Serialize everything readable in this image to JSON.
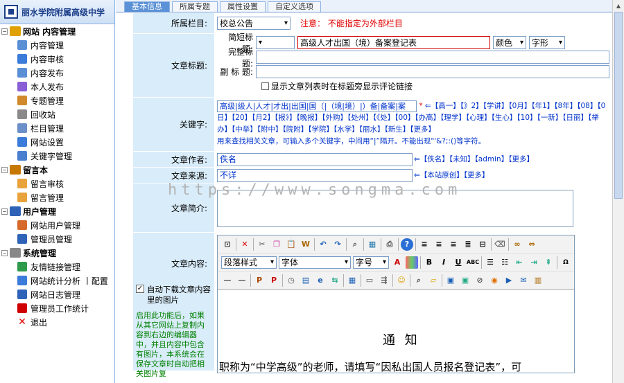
{
  "app": {
    "title": "丽水学院附属高级中学"
  },
  "sidebar": {
    "groups": [
      {
        "label": "网站 内容管理",
        "items": [
          "内容管理",
          "内容审核",
          "内容发布",
          "本人发布",
          "专题管理",
          "回收站",
          "栏目管理",
          "网站设置",
          "关键字管理"
        ]
      },
      {
        "label": "留言本",
        "items": [
          "留言审核",
          "留言管理"
        ]
      },
      {
        "label": "用户管理",
        "items": [
          "网站用户管理",
          "管理员管理"
        ]
      },
      {
        "label": "系统管理",
        "items": [
          "友情链接管理",
          "网站统计分析 丨配置",
          "网站日志管理",
          "管理员工作统计",
          "退出"
        ]
      }
    ]
  },
  "tabs": [
    "基本信息",
    "所属专题",
    "属性设置",
    "自定义选项"
  ],
  "form": {
    "category": {
      "label": "所属栏目:",
      "value": "校总公告",
      "note": "注意： 不能指定为外部栏目"
    },
    "title": {
      "label": "文章标题:",
      "short_label": "简短标题:",
      "short_value": "高级人才出国（境）备案登记表",
      "color_label": "颜色",
      "font_label": "字形",
      "full_label": "完整标题:",
      "sub_label": "副 标 题:",
      "checkbox_label": "显示文章列表时在标题旁显示评论链接"
    },
    "keywords": {
      "label": "关键字:",
      "value": "高级|级人|人才|才出|出国|国（|（境|境）|）备|备案|案",
      "arrow": "⇐【高一】【》2】【学讲】【0月】【年1】【8年】【08】【0日】【20】【月2】【报》】【晚报】【外购】【处州】【《处】【00】【办高】【理学】【心理】【生心】【10】【一新】【日丽】【举办】【中举】【附中】【院附】【学院】【水学】【丽水】【新生】【更多】",
      "hint": "用来查找相关文章，可输入多个关键字，中间用“|”隔开。不能出现\"'&?;:()等字符。"
    },
    "author": {
      "label": "文章作者:",
      "value": "佚名",
      "links": "⇐【佚名】【未知】【admin】【更多】"
    },
    "source": {
      "label": "文章来源:",
      "value": "不详",
      "links": "⇐【本站原创】【更多】"
    },
    "summary": {
      "label": "文章简介:"
    },
    "content": {
      "label": "文章内容:",
      "auto_label": "自动下载文章内容里的图片",
      "auto_hint": "启用此功能后，如果从其它网站上复制内容到右边的编辑器中，并且内容中包含有图片，本系统会在保存文章时自动把相关图片复"
    },
    "editor": {
      "paragraph": "段落样式",
      "font": "字体",
      "size": "字号",
      "heading": "通 知",
      "body": "职称为“中学高级”的老师，请填写“因私出国人员报名登记表”，可"
    }
  },
  "watermark": "https://www.songma.com"
}
